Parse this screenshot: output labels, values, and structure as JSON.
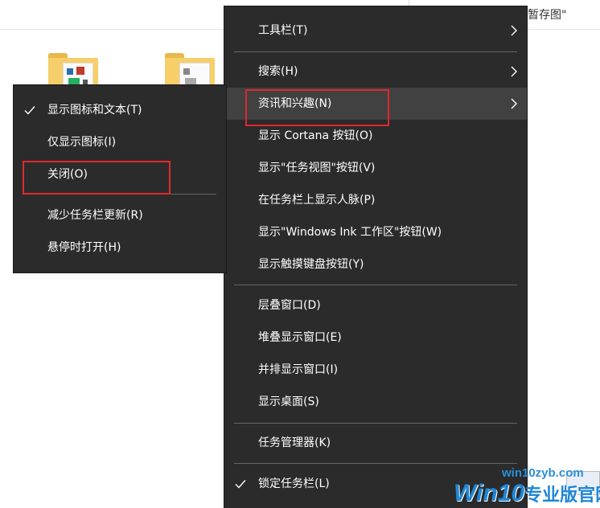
{
  "background": {
    "tab_text": "暂存图\""
  },
  "main_menu": {
    "items": [
      {
        "label": "工具栏(T)",
        "has_submenu": true
      },
      {
        "label": "搜索(H)",
        "has_submenu": true
      },
      {
        "label": "资讯和兴趣(N)",
        "has_submenu": true,
        "highlighted": true
      },
      {
        "label": "显示 Cortana 按钮(O)"
      },
      {
        "label": "显示\"任务视图\"按钮(V)"
      },
      {
        "label": "在任务栏上显示人脉(P)"
      },
      {
        "label": "显示\"Windows Ink 工作区\"按钮(W)"
      },
      {
        "label": "显示触摸键盘按钮(Y)"
      },
      {
        "label": "层叠窗口(D)"
      },
      {
        "label": "堆叠显示窗口(E)"
      },
      {
        "label": "并排显示窗口(I)"
      },
      {
        "label": "显示桌面(S)"
      },
      {
        "label": "任务管理器(K)"
      },
      {
        "label": "锁定任务栏(L)",
        "checked": true
      }
    ]
  },
  "sub_menu": {
    "items": [
      {
        "label": "显示图标和文本(T)",
        "checked": true
      },
      {
        "label": "仅显示图标(I)"
      },
      {
        "label": "关闭(O)"
      },
      {
        "label": "减少任务栏更新(R)"
      },
      {
        "label": "悬停时打开(H)"
      }
    ]
  },
  "watermark": {
    "url": "win10zyb.com",
    "brand": "Win10",
    "suffix": "专业版官网"
  },
  "colors": {
    "menu_bg": "#2b2b2b",
    "menu_hover": "#414141",
    "highlight_box": "#e0282e",
    "watermark_blue": "#1f86d6"
  }
}
